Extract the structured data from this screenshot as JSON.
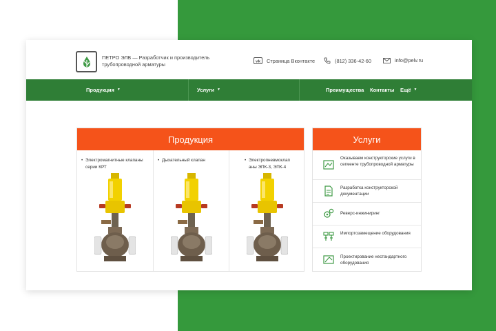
{
  "header": {
    "company_text": "ПЕТРО ЭЛВ — Разработчик и производитель трубопроводной арматуры",
    "vk_label": "Страница Вконтакте",
    "phone": "(812) 336-42-60",
    "email": "info@pelv.ru",
    "icons": {
      "logo": "drop-leaf-logo",
      "vk": "vk-icon",
      "phone": "phone-icon",
      "email": "envelope-icon"
    }
  },
  "nav": {
    "products": "Продукция",
    "services": "Услуги",
    "advantages": "Преимущества",
    "contacts": "Контакты",
    "more": "Ещё"
  },
  "products": {
    "title": "Продукция",
    "items": [
      {
        "label": "Электромагнитные клапаны серии КРТ"
      },
      {
        "label": "Дыхательный клапан"
      },
      {
        "label": "Электропневмоклап аны ЭПК-3, ЭПК-4"
      }
    ]
  },
  "services": {
    "title": "Услуги",
    "items": [
      {
        "label": "Оказываем конструкторские услуги в сегменте трубопроводной арматуры",
        "icon": "blueprint-icon"
      },
      {
        "label": "Разработка конструкторской документации",
        "icon": "document-icon"
      },
      {
        "label": "Реверс-инжиниринг",
        "icon": "gears-icon"
      },
      {
        "label": "Импортозамещение оборудования",
        "icon": "valves-icon"
      },
      {
        "label": "Проектирование нестандартного оборудования",
        "icon": "drafting-icon"
      }
    ]
  },
  "colors": {
    "brand_green": "#2f7e36",
    "background_green": "#35993c",
    "accent_orange": "#f5531a",
    "icon_green": "#3f9a45"
  }
}
